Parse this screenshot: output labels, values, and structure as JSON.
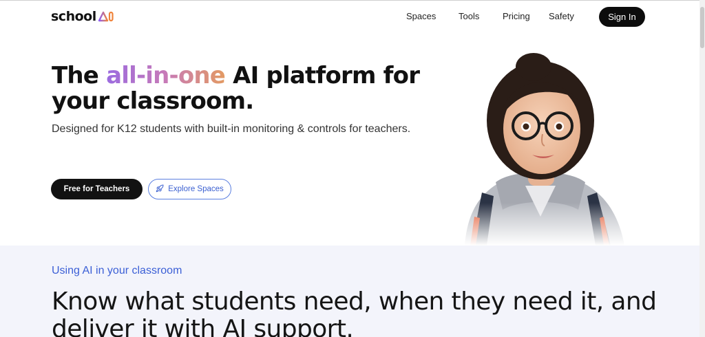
{
  "brand": {
    "logo_text": "school",
    "logo_mark_icon": "school-ai-logo-icon"
  },
  "nav": {
    "items": [
      {
        "label": "Spaces"
      },
      {
        "label": "Tools"
      },
      {
        "label": "Pricing"
      },
      {
        "label": "Safety"
      }
    ],
    "signin_label": "Sign In"
  },
  "hero": {
    "title_before": "The ",
    "title_highlight": "all-in-one",
    "title_after": " AI platform for your classroom.",
    "subtitle": "Designed for K12 students with built-in monitoring & controls for teachers.",
    "primary_button": "Free for Teachers",
    "secondary_button": "Explore Spaces",
    "secondary_icon": "rocket-icon",
    "image_subject": "student-portrait"
  },
  "section": {
    "eyebrow": "Using AI in your classroom",
    "title": "Know what students need, when they need it, and deliver it with AI support."
  },
  "colors": {
    "accent_blue": "#3b5fd6",
    "gradient_start": "#9b6be0",
    "gradient_end": "#e39a62",
    "button_dark": "#121212",
    "section_bg": "#f3f4fb"
  }
}
